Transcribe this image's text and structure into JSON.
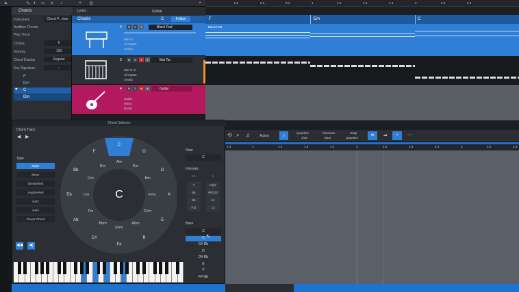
{
  "inspector": {
    "header": "Chords",
    "rows": [
      {
        "label": "Instrument",
        "value": "Chord P...view"
      },
      {
        "label": "Audition Chords",
        "value": ""
      },
      {
        "label": "Play Trace",
        "value": ""
      },
      {
        "label": "Octave",
        "value": "6"
      },
      {
        "label": "Velocity",
        "value": "100"
      },
      {
        "label": "Chord Display",
        "value": "Regular"
      },
      {
        "label": "Key Signature",
        "value": "-"
      }
    ],
    "chords": [
      "F",
      "Em",
      "C",
      "Dm"
    ]
  },
  "tracks_header": {
    "lyrics_label": "Lyrics",
    "global_label": "Global",
    "chords_label": "Chords",
    "chord_value": "C",
    "follow_label": "Follow"
  },
  "tracks": [
    {
      "num": "2",
      "name": "Black Pad",
      "input": "Mai Yu",
      "input2": "All Inputs",
      "output": "Arnsia",
      "color": "#2f7fd6"
    },
    {
      "num": "3",
      "name": "Mai Tai",
      "input": "Mai Yu 2",
      "input2": "All Inputs",
      "output": "Arnsia",
      "color": "#2a2e33"
    },
    {
      "num": "4",
      "name": "Guitar",
      "input": "Guitar",
      "input2": "Mono",
      "output": "Daisis",
      "color": "#b3195f"
    }
  ],
  "ruler_marks": [
    "0.2",
    "0.3",
    "0.4",
    "1",
    "1.2",
    "1.3",
    "1.4",
    "2",
    "2.2",
    "2.3"
  ],
  "chord_track": [
    "F",
    "Em",
    "C"
  ],
  "clip_label": "Black Pad",
  "selector": {
    "title": "Chord Selector",
    "chord_track_label": "Chord Track",
    "type_label": "Type",
    "types": [
      "Major",
      "Minor",
      "Diminished",
      "Augmented",
      "sus2",
      "sus4",
      "Power Chord"
    ],
    "selected_type": "Major",
    "center": "C",
    "outer": [
      "C",
      "G",
      "D",
      "A",
      "E",
      "B",
      "F#",
      "C#",
      "Ab",
      "Eb",
      "Bb",
      "F"
    ],
    "inner": [
      "Am",
      "Em",
      "Bm",
      "F#m",
      "C#m",
      "Abm",
      "Ebm",
      "Bbm",
      "Fm",
      "Cm",
      "Gm",
      "Dm"
    ],
    "root_label": "Root",
    "root_value": "C",
    "intervals_label": "Intervals",
    "intervals": [
      "b9",
      "9",
      "7",
      "maj7",
      "b5",
      "#5 b13",
      "b6",
      "11",
      "#11",
      "13"
    ],
    "bass_label": "Bass",
    "bass_value": "C",
    "bass_list": [
      "C",
      "C#  Db",
      "D",
      "D#  Eb",
      "E",
      "F",
      "F#  Gb"
    ],
    "bass_selected": "C"
  },
  "editor": {
    "action_label": "Action",
    "quantize_label": "Quantize",
    "quantize_value": "1/16",
    "timebase_label": "Timebase",
    "timebase_value": "Bars",
    "snap_label": "Snap",
    "snap_value": "Quantize",
    "ruler_marks": [
      "1.4",
      "1",
      "1.2",
      "1.3",
      "1.4",
      "2",
      "2.2",
      "2.3",
      "2.4",
      "3",
      "3.2",
      "3.3"
    ]
  },
  "colors": {
    "accent": "#2f7fd6",
    "guitar": "#b3195f",
    "bg": "#1b1e22"
  }
}
